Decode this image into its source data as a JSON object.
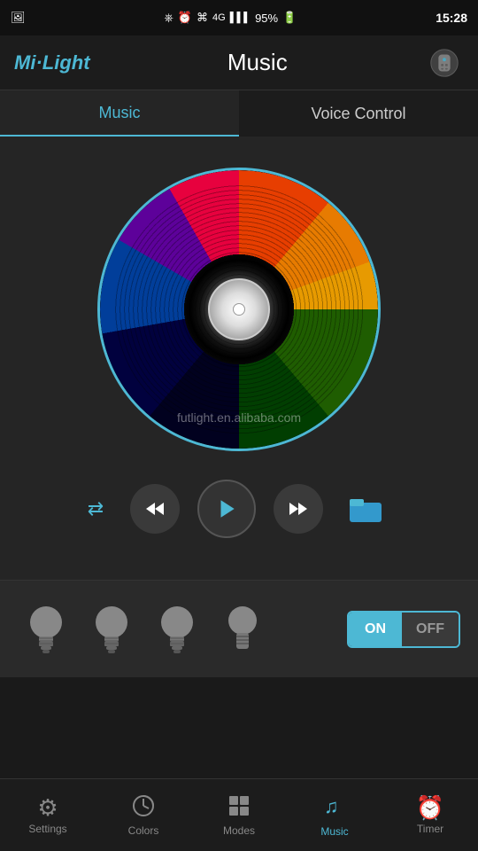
{
  "statusBar": {
    "time": "15:28",
    "battery": "95%",
    "signal": "4G",
    "icons": [
      "bluetooth",
      "alarm",
      "wifi"
    ]
  },
  "header": {
    "logo": "Mi·Light",
    "title": "Music",
    "iconLabel": "hand-remote-icon"
  },
  "tabs": [
    {
      "id": "music",
      "label": "Music",
      "active": true
    },
    {
      "id": "voice",
      "label": "Voice Control",
      "active": false
    }
  ],
  "disc": {
    "watermark": "futlight.en.alibaba.com"
  },
  "controls": {
    "repeat": "⇄",
    "rewind": "⏮",
    "play": "▶",
    "forward": "⏭",
    "folder": "📁"
  },
  "bulbs": [
    {
      "id": 1
    },
    {
      "id": 2
    },
    {
      "id": 3
    },
    {
      "id": 4
    }
  ],
  "toggle": {
    "on": "ON",
    "off": "OFF"
  },
  "bottomNav": [
    {
      "id": "settings",
      "label": "Settings",
      "icon": "⚙",
      "active": false
    },
    {
      "id": "colors",
      "label": "Colors",
      "icon": "🕐",
      "active": false
    },
    {
      "id": "modes",
      "label": "Modes",
      "icon": "⊞",
      "active": false
    },
    {
      "id": "music",
      "label": "Music",
      "icon": "♫",
      "active": true
    },
    {
      "id": "timer",
      "label": "Timer",
      "icon": "⏰",
      "active": false
    }
  ]
}
